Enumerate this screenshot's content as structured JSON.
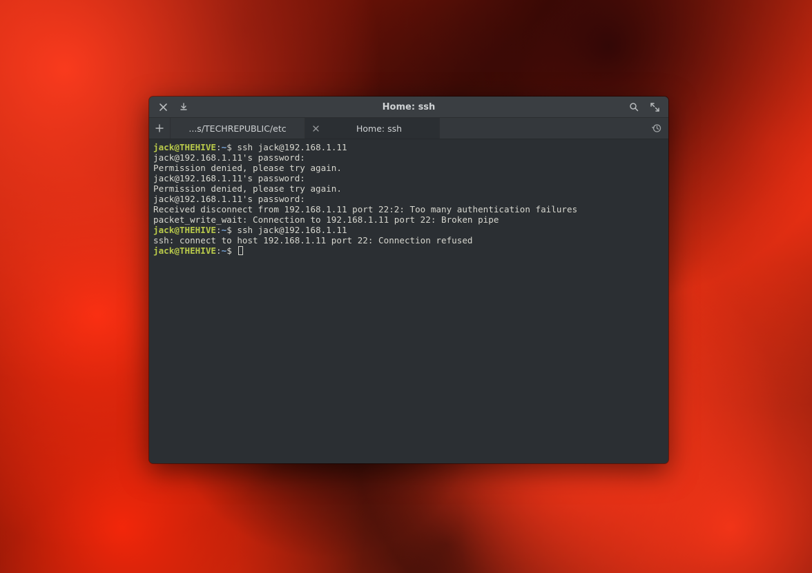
{
  "window": {
    "title": "Home: ssh"
  },
  "tabs": [
    {
      "label": "...s/TECHREPUBLIC/etc",
      "active": false
    },
    {
      "label": "Home: ssh",
      "active": true
    }
  ],
  "prompt": {
    "user": "jack@THEHIVE",
    "sep": ":",
    "path": "~",
    "symbol": "$"
  },
  "lines": [
    {
      "type": "cmd",
      "text": " ssh jack@192.168.1.11"
    },
    {
      "type": "out",
      "text": "jack@192.168.1.11's password:"
    },
    {
      "type": "out",
      "text": "Permission denied, please try again."
    },
    {
      "type": "out",
      "text": "jack@192.168.1.11's password:"
    },
    {
      "type": "out",
      "text": "Permission denied, please try again."
    },
    {
      "type": "out",
      "text": "jack@192.168.1.11's password:"
    },
    {
      "type": "out",
      "text": "Received disconnect from 192.168.1.11 port 22:2: Too many authentication failures"
    },
    {
      "type": "out",
      "text": "packet_write_wait: Connection to 192.168.1.11 port 22: Broken pipe"
    },
    {
      "type": "cmd",
      "text": " ssh jack@192.168.1.11"
    },
    {
      "type": "out",
      "text": "ssh: connect to host 192.168.1.11 port 22: Connection refused"
    },
    {
      "type": "cmd",
      "text": " ",
      "cursor": true
    }
  ],
  "colors": {
    "bg": "#2b2f33",
    "titlebar": "#3a3e42",
    "tabbar": "#34383c",
    "text": "#d7d7cf",
    "user": "#b9ca4a",
    "path": "#7aa6da"
  }
}
